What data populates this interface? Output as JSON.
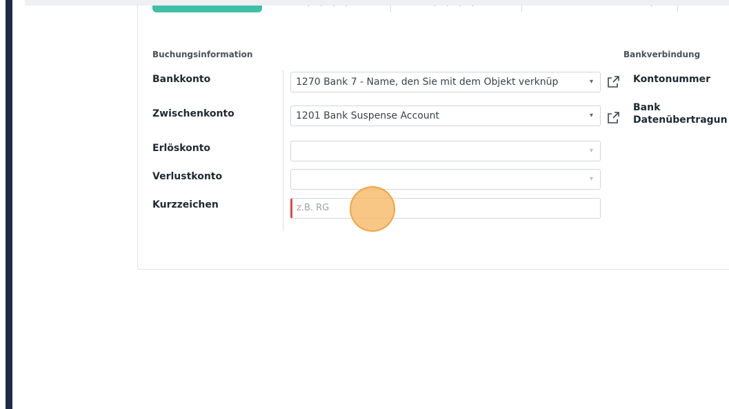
{
  "section": {
    "booking_title": "Buchungsinformation",
    "bank_title": "Bankverbindung"
  },
  "fields": {
    "bankkonto": {
      "label": "Bankkonto",
      "value": "1270 Bank 7 - Name, den Sie mit dem Objekt verknüp"
    },
    "zwischenkonto": {
      "label": "Zwischenkonto",
      "value": "1201 Bank Suspense Account"
    },
    "erloeskonto": {
      "label": "Erlöskonto",
      "value": ""
    },
    "verlustkonto": {
      "label": "Verlustkonto",
      "value": ""
    },
    "kurzzeichen": {
      "label": "Kurzzeichen",
      "placeholder": "z.B. RG",
      "value": ""
    }
  },
  "bank": {
    "kontonummer": "Kontonummer",
    "datenuebertragung_line1": "Bank",
    "datenuebertragung_line2": "Datenübertragun"
  },
  "icons": {
    "caret": "▾",
    "external": "external-link-icon"
  },
  "colors": {
    "accent": "#3fbfa6",
    "required": "#e0434d",
    "sidebar": "#1f2a44"
  }
}
